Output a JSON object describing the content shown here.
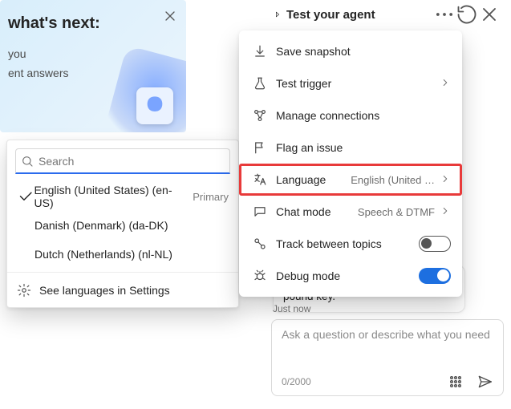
{
  "promo": {
    "title_fragment": "what's next:",
    "bullet1_fragment": "you",
    "bullet2_fragment": "ent answers"
  },
  "language_popover": {
    "search_placeholder": "Search",
    "footer": "See languages in Settings",
    "items": [
      {
        "label": "English (United States) (en-US)",
        "tag": "Primary",
        "selected": true
      },
      {
        "label": "Danish (Denmark) (da-DK)",
        "tag": "",
        "selected": false
      },
      {
        "label": "Dutch (Netherlands) (nl-NL)",
        "tag": "",
        "selected": false
      }
    ]
  },
  "test_panel": {
    "title": "Test your agent"
  },
  "menu": {
    "save_snapshot": "Save snapshot",
    "test_trigger": "Test trigger",
    "manage_connections": "Manage connections",
    "flag_issue": "Flag an issue",
    "language_label": "Language",
    "language_value": "English (United …",
    "chat_mode_label": "Chat mode",
    "chat_mode_value": "Speech & DTMF",
    "track_topics": "Track between topics",
    "track_topics_on": false,
    "debug_mode": "Debug mode",
    "debug_mode_on": true
  },
  "chat": {
    "last_message": "To hear this menu again, press the pound key.",
    "timestamp": "Just now",
    "composer_placeholder": "Ask a question or describe what you need",
    "counter": "0/2000"
  }
}
